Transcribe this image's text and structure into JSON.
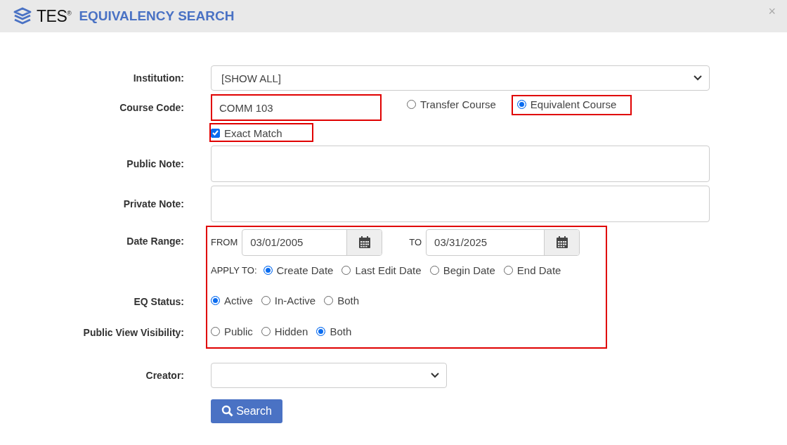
{
  "dialog": {
    "logo": "TES$^{®}$",
    "title": "EQUIVALENCY SEARCH",
    "close": "×"
  },
  "form": {
    "institution": {
      "label": "Institution:",
      "value": "[SHOW ALL]"
    },
    "course_code": {
      "label": "Course Code:",
      "value": "COMM 103",
      "highlighted": true,
      "course_type": [
        {
          "label": "Transfer Course",
          "selected": false,
          "highlighted": false
        },
        {
          "label": "Equivalent Course",
          "selected": true,
          "highlighted": true
        }
      ],
      "exact_match": {
        "label": "Exact Match",
        "checked": true,
        "highlighted": true
      }
    },
    "public_note": {
      "label": "Public Note:"
    },
    "private_note": {
      "label": "Private Note:"
    },
    "criteria_highlighted": true,
    "date_range": {
      "label": "Date Range:",
      "from_label": "FROM",
      "from": "03/01/2005",
      "to_label": "TO",
      "to": "03/31/2025",
      "apply_to_label": "APPLY TO:",
      "apply_to": [
        {
          "label": "Create Date",
          "selected": true
        },
        {
          "label": "Last Edit Date",
          "selected": false
        },
        {
          "label": "Begin Date",
          "selected": false
        },
        {
          "label": "End Date",
          "selected": false
        }
      ]
    },
    "eq_status": {
      "label": "EQ Status:",
      "options": [
        {
          "label": "Active",
          "selected": true
        },
        {
          "label": "In-Active",
          "selected": false
        },
        {
          "label": "Both",
          "selected": false
        }
      ]
    },
    "public_view_visibility": {
      "label": "Public View Visibility:",
      "options": [
        {
          "label": "Public",
          "selected": false
        },
        {
          "label": "Hidden",
          "selected": false
        },
        {
          "label": "Both",
          "selected": true
        }
      ]
    },
    "creator": {
      "label": "Creator:"
    },
    "search_button": "Search"
  }
}
